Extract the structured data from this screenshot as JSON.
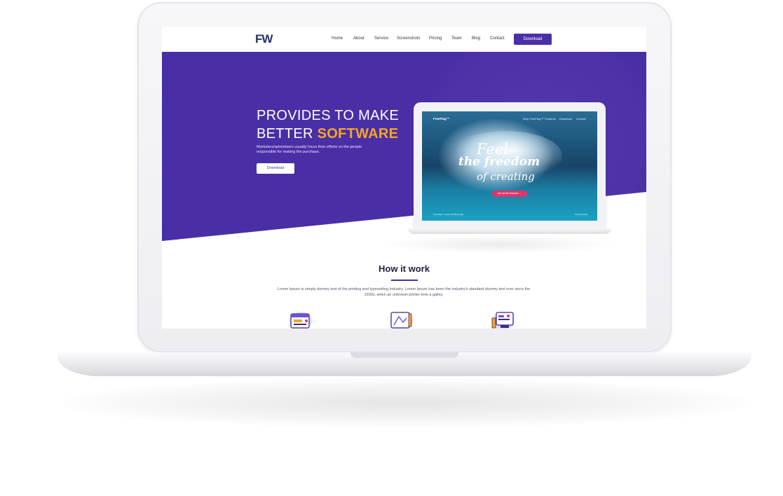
{
  "site": {
    "logo": "FW",
    "nav": {
      "links": [
        "Home",
        "About",
        "Service",
        "Screenshots",
        "Pricing",
        "Team",
        "Blog",
        "Contact"
      ],
      "cta": "Download"
    },
    "hero": {
      "title_line1": "PROVIDES TO MAKE",
      "title_line2_prefix": "BETTER ",
      "title_line2_accent": "SOFTWARE",
      "description": "Marketers/advertisers usually focus their efforts on the people responsible for making the purchase.",
      "button": "Download"
    },
    "mockup": {
      "brand": "FreeFlag™",
      "links": [
        "Why FreeFlag™",
        "Features",
        "Download",
        "Contact"
      ],
      "headline_1": "Feel",
      "headline_2": "the freedom",
      "headline_3": "of creating",
      "cta": "see all the features →",
      "footer_left": "FreeFlag™ made with Bootstrap",
      "footer_right": "Privacy Policy"
    },
    "how_it_works": {
      "title": "How it work",
      "text": "Lorem Ipsum is simply dummy text of the printing and typesetting industry. Lorem Ipsum has been the industry's standard dummy text ever since the 1500s, when an unknown printer took a galley.",
      "icons": [
        "browser-window-icon",
        "drawing-board-icon",
        "monitor-dashboard-icon"
      ]
    }
  },
  "colors": {
    "primary": "#4a2ea6",
    "accent": "#f5a623",
    "cta_pink": "#e2336b"
  }
}
